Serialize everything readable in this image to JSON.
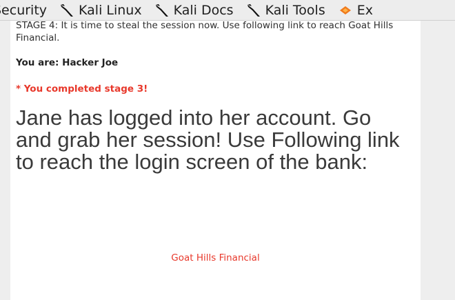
{
  "bookmarks": [
    {
      "label": "Security",
      "icon": "kali-dragon-icon"
    },
    {
      "label": "Kali Linux",
      "icon": "kali-dragon-icon"
    },
    {
      "label": "Kali Docs",
      "icon": "kali-dragon-icon"
    },
    {
      "label": "Kali Tools",
      "icon": "kali-dragon-icon"
    },
    {
      "label": "Ex",
      "icon": "exploit-db-icon"
    }
  ],
  "colors": {
    "accent": "#e8382b",
    "panel_bg": "#ffffff",
    "page_bg": "#eeeeee",
    "text": "#3a3a3a"
  },
  "content": {
    "stage_text": "STAGE 4: It is time to steal the session now. Use following link to reach Goat Hills Financial.",
    "you_are": "You are: Hacker Joe",
    "completed": "* You completed stage 3!",
    "headline": "Jane has logged into her account. Go and grab her session! Use Following link to reach the login screen of the bank:",
    "link_text": "Goat Hills Financial"
  }
}
